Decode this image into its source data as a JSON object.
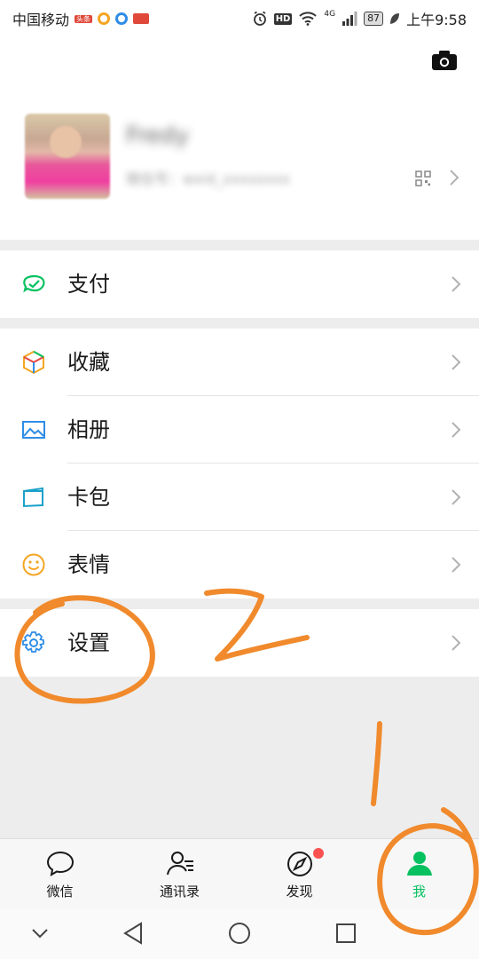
{
  "status_bar": {
    "carrier": "中国移动",
    "badge_text": "头条",
    "network": "4G",
    "battery": "87",
    "time": "上午9:58"
  },
  "profile": {
    "nickname": "Fredy",
    "wechat_id": "微信号：wxid_xxxxxxxx"
  },
  "menu": {
    "pay": "支付",
    "favorites": "收藏",
    "album": "相册",
    "cards": "卡包",
    "stickers": "表情",
    "settings": "设置"
  },
  "tabs": [
    {
      "label": "微信"
    },
    {
      "label": "通讯录"
    },
    {
      "label": "发现"
    },
    {
      "label": "我"
    }
  ],
  "colors": {
    "accent_green": "#07c160",
    "annotation_orange": "#f08a2c",
    "badge_red": "#fa5151"
  },
  "annotations": [
    "1",
    "2"
  ]
}
